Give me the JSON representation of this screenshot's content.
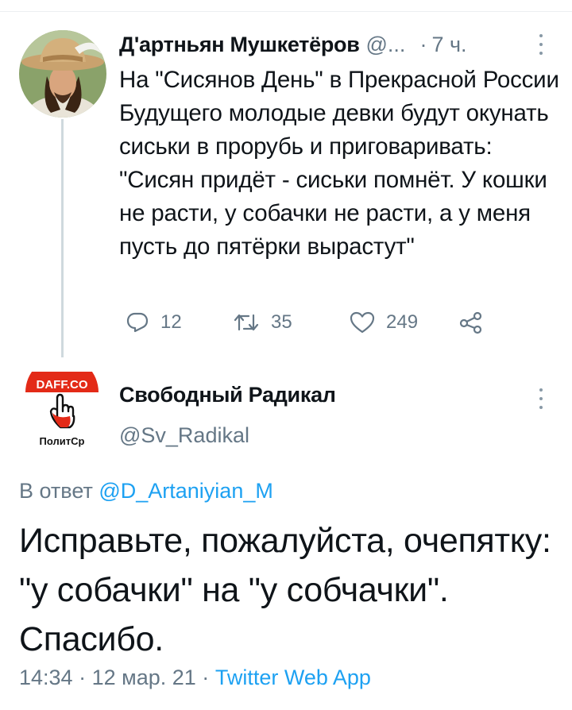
{
  "tweet1": {
    "name": "Д'артньян Мушкетёров",
    "handle": "@...",
    "time_sep": "·",
    "time": "7 ч.",
    "text": "На \"Сисянов День\" в Прекрасной России Будущего молодые девки будут окунать сиськи в прорубь и приговаривать: \"Сисян придёт - сиськи помнёт. У кошки не расти, у собачки не расти, а у меня пусть до пятёрки вырастут\"",
    "replies": "12",
    "retweets": "35",
    "likes": "249"
  },
  "tweet2": {
    "avatar_lettering": {
      "top": "DAFF.CO",
      "bottom": "ПолитСр"
    },
    "name": "Свободный Радикал",
    "handle": "@Sv_Radikal",
    "reply_prefix": "В ответ",
    "reply_mention": "@D_Artaniyian_M",
    "text": "Исправьте, пожалуйста, очепятку: \"у собачки\" на \"у собчачки\". Спасибо.",
    "time": "14:34",
    "sep1": "·",
    "date": "12 мар. 21",
    "sep2": "·",
    "source": "Twitter Web App"
  },
  "icons": {
    "more": "more-vertical-icon",
    "reply": "reply-icon",
    "retweet": "retweet-icon",
    "like": "heart-icon",
    "share": "share-icon"
  },
  "colors": {
    "text": "#0f1419",
    "secondary": "#657786",
    "link": "#1da1f2",
    "icon": "#8899a6",
    "thread_line": "#cfd9de",
    "logo_red": "#e32a17"
  }
}
